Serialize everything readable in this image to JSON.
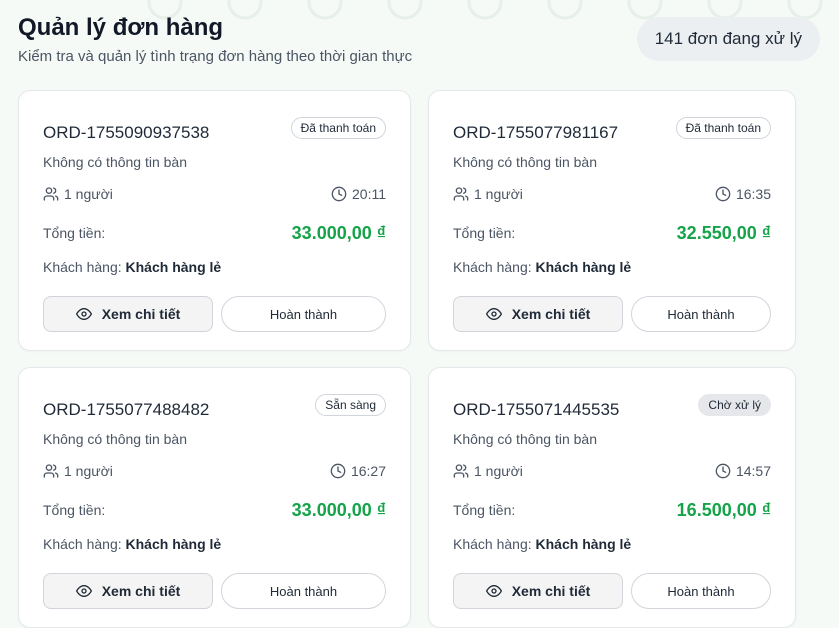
{
  "header": {
    "title": "Quản lý đơn hàng",
    "subtitle": "Kiểm tra và quản lý tình trạng đơn hàng theo thời gian thực",
    "count_label": "141 đơn đang xử lý"
  },
  "colors": {
    "accent": "#16a34a",
    "background": "#f6faf7"
  },
  "labels": {
    "total": "Tổng tiền:",
    "customer": "Khách hàng:",
    "view_detail": "Xem chi tiết",
    "complete": "Hoàn thành"
  },
  "icons": {
    "people": "users-icon",
    "time": "clock-icon",
    "view": "eye-icon"
  },
  "orders": [
    {
      "id": "ORD-1755090937538",
      "status": "Đã thanh toán",
      "table": "Không có thông tin bàn",
      "guests": "1 người",
      "time": "20:11",
      "total": "33.000,00 ₫",
      "customer": "Khách hàng lẻ"
    },
    {
      "id": "ORD-1755077981167",
      "status": "Đã thanh toán",
      "table": "Không có thông tin bàn",
      "guests": "1 người",
      "time": "16:35",
      "total": "32.550,00 ₫",
      "customer": "Khách hàng lẻ"
    },
    {
      "id": "ORD-1755077488482",
      "status": "Sẵn sàng",
      "table": "Không có thông tin bàn",
      "guests": "1 người",
      "time": "16:27",
      "total": "33.000,00 ₫",
      "customer": "Khách hàng lẻ"
    },
    {
      "id": "ORD-1755071445535",
      "status": "Chờ xử lý",
      "table": "Không có thông tin bàn",
      "guests": "1 người",
      "time": "14:57",
      "total": "16.500,00 ₫",
      "customer": "Khách hàng lẻ"
    }
  ]
}
